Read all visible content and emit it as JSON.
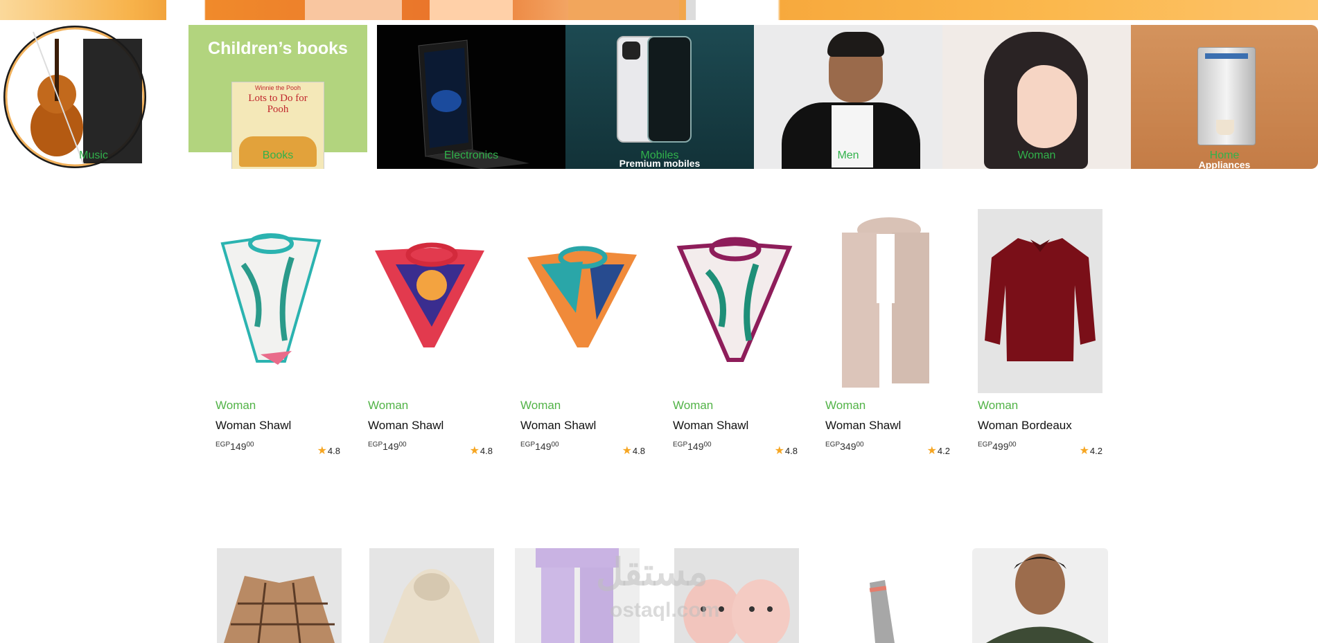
{
  "categories": [
    {
      "name": "music",
      "label": "Music"
    },
    {
      "name": "books",
      "label": "Books",
      "banner_text": "Children’s books",
      "book_title": "Lots to Do for Pooh",
      "book_brand": "Winnie the Pooh"
    },
    {
      "name": "electronics",
      "label": "Electronics"
    },
    {
      "name": "mobiles",
      "label": "Mobiles",
      "sub": "Premium mobiles"
    },
    {
      "name": "men",
      "label": "Men"
    },
    {
      "name": "woman",
      "label": "Woman"
    },
    {
      "name": "home",
      "label": "Home",
      "sub": "Appliances"
    }
  ],
  "products": [
    {
      "category": "Woman",
      "title": "Woman Shawl",
      "currency": "EGP",
      "price_int": "149",
      "price_dec": "00",
      "rating": "4.8",
      "image": "floral-scarf-teal"
    },
    {
      "category": "Woman",
      "title": "Woman Shawl",
      "currency": "EGP",
      "price_int": "149",
      "price_dec": "00",
      "rating": "4.8",
      "image": "scarf-red-blue"
    },
    {
      "category": "Woman",
      "title": "Woman Shawl",
      "currency": "EGP",
      "price_int": "149",
      "price_dec": "00",
      "rating": "4.8",
      "image": "scarf-orange-teal"
    },
    {
      "category": "Woman",
      "title": "Woman Shawl",
      "currency": "EGP",
      "price_int": "149",
      "price_dec": "00",
      "rating": "4.8",
      "image": "scarf-purple-floral"
    },
    {
      "category": "Woman",
      "title": "Woman Shawl",
      "currency": "EGP",
      "price_int": "349",
      "price_dec": "00",
      "rating": "4.2",
      "image": "beige-long-scarf"
    },
    {
      "category": "Woman",
      "title": "Woman Bordeaux",
      "currency": "EGP",
      "price_int": "499",
      "price_dec": "00",
      "rating": "4.2",
      "image": "bordeaux-shirt"
    }
  ],
  "watermark": {
    "arabic": "مستقل",
    "latin": "ostaql.com"
  },
  "colors": {
    "accent_green": "#31b24b",
    "category_green": "#52b347",
    "star": "#f6a623"
  }
}
